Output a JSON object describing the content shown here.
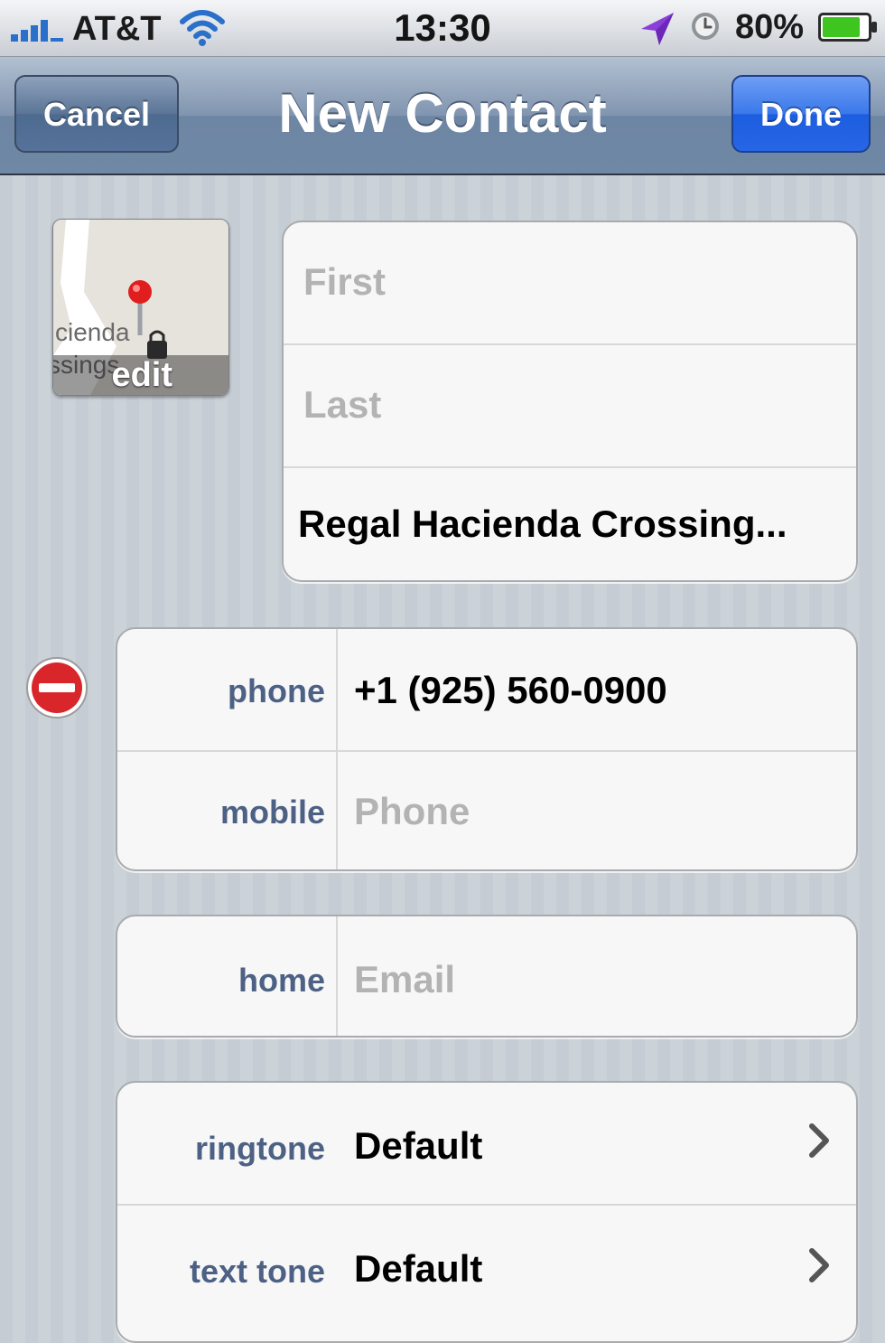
{
  "status_bar": {
    "carrier": "AT&T",
    "time": "13:30",
    "battery_percent": "80%",
    "battery_level": 0.8,
    "icons": [
      "signal-icon",
      "wifi-icon",
      "location-arrow-icon",
      "alarm-clock-icon",
      "battery-icon"
    ]
  },
  "nav": {
    "title": "New Contact",
    "cancel_label": "Cancel",
    "done_label": "Done"
  },
  "photo": {
    "edit_label": "edit",
    "map_text_1": "cienda",
    "map_text_2": "ssings"
  },
  "name_fields": {
    "first_placeholder": "First",
    "last_placeholder": "Last",
    "company_value": "Regal Hacienda Crossing..."
  },
  "phones": [
    {
      "label": "phone",
      "value": "+1 (925) 560-0900",
      "placeholder": ""
    },
    {
      "label": "mobile",
      "value": "",
      "placeholder": "Phone"
    }
  ],
  "email": {
    "label": "home",
    "placeholder": "Email"
  },
  "tones": [
    {
      "label": "ringtone",
      "value": "Default"
    },
    {
      "label": "text tone",
      "value": "Default"
    }
  ],
  "colors": {
    "nav_blue": "#6d86a3",
    "done_blue": "#2766e6",
    "label_blue": "#4d6185",
    "remove_red": "#d9262a"
  }
}
